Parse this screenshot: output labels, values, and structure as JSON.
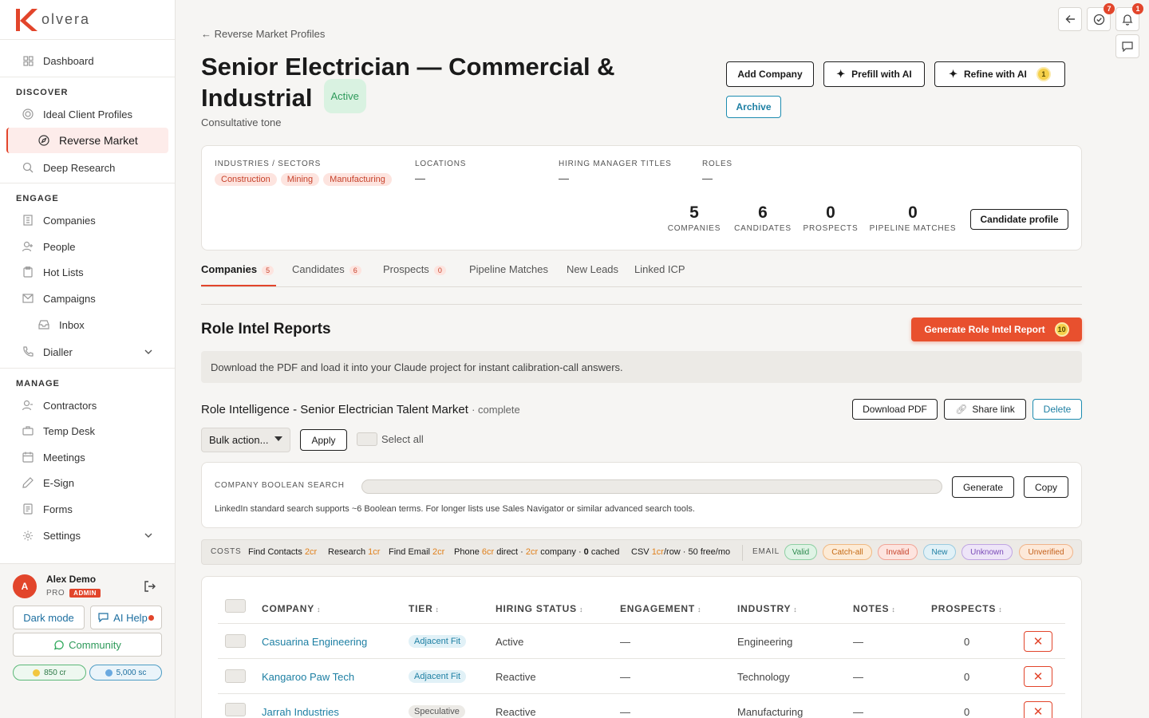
{
  "brand": {
    "name": "olvera",
    "accent": "#e2452b"
  },
  "sidebar": {
    "dashboard": "Dashboard",
    "sections": {
      "discover": "DISCOVER",
      "engage": "ENGAGE",
      "manage": "MANAGE"
    },
    "items": {
      "icp": "Ideal Client Profiles",
      "reverse_market": "Reverse Market",
      "deep_research": "Deep Research",
      "companies": "Companies",
      "people": "People",
      "hot_lists": "Hot Lists",
      "campaigns": "Campaigns",
      "inbox": "Inbox",
      "dialler": "Dialler",
      "contractors": "Contractors",
      "temp_desk": "Temp Desk",
      "meetings": "Meetings",
      "esign": "E-Sign",
      "forms": "Forms",
      "settings": "Settings"
    },
    "user": {
      "initial": "A",
      "name": "Alex Demo",
      "plan": "PRO",
      "role": "ADMIN"
    },
    "dark_mode": "Dark mode",
    "ai_help": "AI Help",
    "community": "Community",
    "credits": {
      "cr": "850 cr",
      "sc": "5,000 sc"
    }
  },
  "topbar": {
    "tasks_count": "7",
    "notifications_count": "1"
  },
  "header": {
    "back": "← Reverse Market Profiles",
    "title": "Senior Electrician — Commercial & Industrial",
    "status": "Active",
    "subtitle": "Consultative tone",
    "buttons": {
      "add_company": "Add Company",
      "prefill": "Prefill with AI",
      "refine": "Refine with AI",
      "refine_cost": "1",
      "archive": "Archive"
    }
  },
  "profile": {
    "industries_label": "INDUSTRIES / SECTORS",
    "industries": [
      "Construction",
      "Mining",
      "Manufacturing"
    ],
    "locations_label": "LOCATIONS",
    "locations": "—",
    "hiring_label": "HIRING MANAGER TITLES",
    "hiring": "—",
    "roles_label": "ROLES",
    "roles": "—",
    "stats": [
      {
        "value": "5",
        "label": "COMPANIES"
      },
      {
        "value": "6",
        "label": "CANDIDATES"
      },
      {
        "value": "0",
        "label": "PROSPECTS"
      },
      {
        "value": "0",
        "label": "PIPELINE MATCHES"
      }
    ],
    "candidate_profile": "Candidate profile"
  },
  "tabs": [
    {
      "label": "Companies",
      "count": "5"
    },
    {
      "label": "Candidates",
      "count": "6"
    },
    {
      "label": "Prospects",
      "count": "0"
    },
    {
      "label": "Pipeline Matches"
    },
    {
      "label": "New Leads"
    },
    {
      "label": "Linked ICP"
    }
  ],
  "reports": {
    "title": "Role Intel Reports",
    "generate": "Generate Role Intel Report",
    "generate_cost": "10",
    "info": "Download the PDF and load it into your Claude project for instant calibration-call answers.",
    "report_name": "Role Intelligence - Senior Electrician Talent Market",
    "report_status": "· complete",
    "download": "Download PDF",
    "share": "Share link",
    "delete": "Delete"
  },
  "bulk": {
    "select": "Bulk action...",
    "apply": "Apply",
    "select_all": "Select all"
  },
  "boolean": {
    "label": "COMPANY BOOLEAN SEARCH",
    "value": "",
    "generate": "Generate",
    "copy": "Copy",
    "note": "LinkedIn standard search supports ~6 Boolean terms. For longer lists use Sales Navigator or similar advanced search tools."
  },
  "costs": {
    "label": "COSTS",
    "find_contacts": "Find Contacts",
    "find_contacts_cr": "2cr",
    "research": "Research",
    "research_cr": "1cr",
    "find_email": "Find Email",
    "find_email_cr": "2cr",
    "phone": "Phone",
    "phone_direct_cr": "6cr",
    "phone_direct": "direct ·",
    "phone_company_cr": "2cr",
    "phone_company": "company ·",
    "cached_num": "0",
    "cached": "cached",
    "csv": "CSV",
    "csv_cr": "1cr",
    "csv_rest": "/row · 50 free/mo",
    "email_label": "EMAIL",
    "email_states": [
      "Valid",
      "Catch-all",
      "Invalid",
      "New",
      "Unknown",
      "Unverified"
    ]
  },
  "table": {
    "headers": [
      "COMPANY",
      "TIER",
      "HIRING STATUS",
      "ENGAGEMENT",
      "INDUSTRY",
      "NOTES",
      "PROSPECTS"
    ],
    "rows": [
      {
        "company": "Casuarina Engineering",
        "tier": "Adjacent Fit",
        "hiring": "Active",
        "engagement": "—",
        "industry": "Engineering",
        "notes": "—",
        "prospects": "0"
      },
      {
        "company": "Kangaroo Paw Tech",
        "tier": "Adjacent Fit",
        "hiring": "Reactive",
        "engagement": "—",
        "industry": "Technology",
        "notes": "—",
        "prospects": "0"
      },
      {
        "company": "Jarrah Industries",
        "tier": "Speculative",
        "hiring": "Reactive",
        "engagement": "—",
        "industry": "Manufacturing",
        "notes": "—",
        "prospects": "0"
      }
    ]
  }
}
